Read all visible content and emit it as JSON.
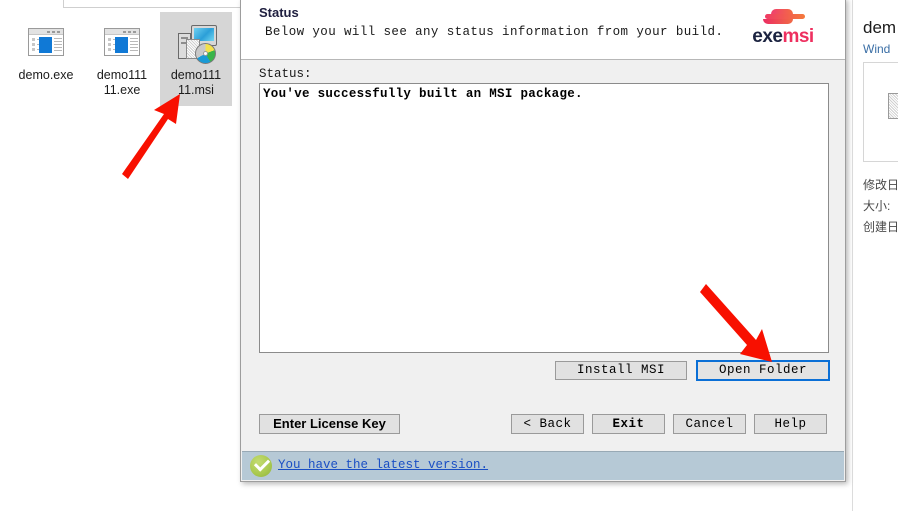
{
  "explorer": {
    "files": [
      {
        "label": "demo.exe",
        "icon": "exe-file-icon",
        "selected": false
      },
      {
        "label": "demo111\n11.exe",
        "icon": "exe-file-icon",
        "selected": false
      },
      {
        "label": "demo111\n11.msi",
        "icon": "msi-file-icon",
        "selected": true
      }
    ],
    "detail_panel": {
      "title": "dem",
      "subtitle": "Wind",
      "meta": [
        "修改日",
        "大小:",
        "创建日"
      ]
    }
  },
  "dialog": {
    "header": {
      "title": "Status",
      "subtitle": "Below you will see any status information from your build.",
      "logo": {
        "exe": "exe",
        "msi": "msi",
        "icon": "exemsi-logo-icon"
      }
    },
    "status_label": "Status:",
    "status_text": "You've successfully built an MSI package.",
    "action_buttons": [
      {
        "name": "install-msi-button",
        "label": "Install MSI",
        "focused": false
      },
      {
        "name": "open-folder-button",
        "label": "Open Folder",
        "focused": true
      }
    ],
    "nav_buttons": [
      {
        "name": "enter-license-key-button",
        "label": "Enter License Key",
        "style": "sans"
      },
      {
        "name": "back-button",
        "label": "< Back",
        "style": "mono"
      },
      {
        "name": "exit-button",
        "label": "Exit",
        "style": "mono-bold"
      },
      {
        "name": "cancel-button",
        "label": "Cancel",
        "style": "mono"
      },
      {
        "name": "help-button",
        "label": "Help",
        "style": "mono"
      }
    ],
    "footer": {
      "icon": "green-check-icon",
      "link_text": "You have the latest version."
    }
  },
  "annotations": {
    "arrow_color": "#f81000",
    "arrows": [
      {
        "name": "arrow-to-msi-file",
        "points_to": "demo11111.msi"
      },
      {
        "name": "arrow-to-open-folder",
        "points_to": "Open Folder"
      }
    ]
  }
}
